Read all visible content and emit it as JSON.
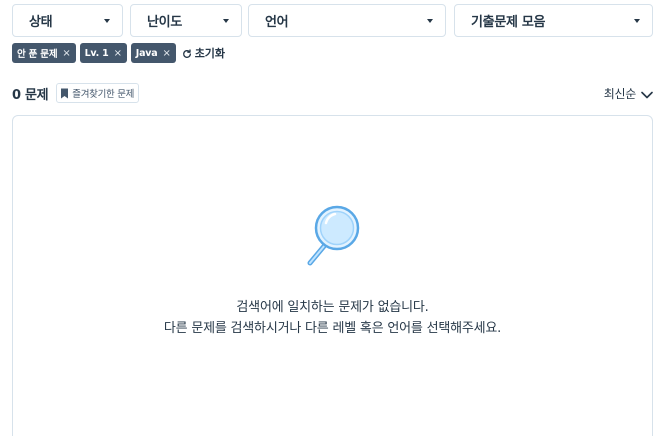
{
  "filters": {
    "status": "상태",
    "level": "난이도",
    "language": "언어",
    "collection": "기출문제 모음"
  },
  "chips": [
    {
      "label": "안 푼 문제",
      "remove": "×"
    },
    {
      "label": "Lv. 1",
      "remove": "×"
    },
    {
      "label": "Java",
      "remove": "×"
    }
  ],
  "reset_label": "초기화",
  "result": {
    "count": "0 문제",
    "bookmark_label": "즐겨찾기한 문제",
    "sort_label": "최신순"
  },
  "empty": {
    "line1": "검색어에 일치하는 문제가 없습니다.",
    "line2": "다른 문제를 검색하시거나 다른 레벨 혹은 언어를 선택해주세요."
  },
  "icons": {
    "caret": "caret-down-icon",
    "reset": "refresh-icon",
    "bookmark": "bookmark-icon",
    "sort": "chevron-down-icon",
    "empty": "magnifier-icon"
  },
  "colors": {
    "chip_bg": "#44576c",
    "text": "#263747",
    "border": "#d7e2eb",
    "magnifier_glass": "#bfe3ff",
    "magnifier_stroke": "#5aa8e6"
  }
}
